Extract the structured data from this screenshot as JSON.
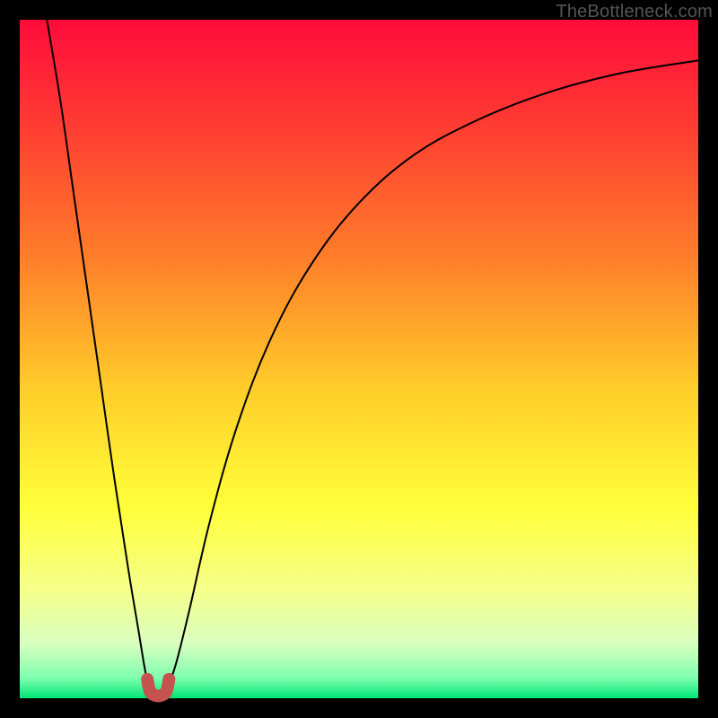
{
  "watermark": "TheBottleneck.com",
  "chart_data": {
    "type": "line",
    "title": "",
    "xlabel": "",
    "ylabel": "",
    "xlim": [
      0,
      100
    ],
    "ylim": [
      0,
      100
    ],
    "background_gradient": {
      "stops": [
        {
          "pos": 0.0,
          "color": "#ff0b3b"
        },
        {
          "pos": 0.15,
          "color": "#ff3a32"
        },
        {
          "pos": 0.35,
          "color": "#ff7e2a"
        },
        {
          "pos": 0.55,
          "color": "#ffcf2a"
        },
        {
          "pos": 0.72,
          "color": "#ffff3a"
        },
        {
          "pos": 0.84,
          "color": "#f5ff8a"
        },
        {
          "pos": 0.92,
          "color": "#d8ffc0"
        },
        {
          "pos": 0.97,
          "color": "#7fffb0"
        },
        {
          "pos": 1.0,
          "color": "#00e676"
        }
      ]
    },
    "series": [
      {
        "name": "bottleneck-curve",
        "stroke": "#000000",
        "stroke_width": 2,
        "points": [
          {
            "x": 4.0,
            "y": 100.0
          },
          {
            "x": 6.0,
            "y": 88.0
          },
          {
            "x": 8.0,
            "y": 74.0
          },
          {
            "x": 10.0,
            "y": 60.0
          },
          {
            "x": 12.0,
            "y": 46.0
          },
          {
            "x": 14.0,
            "y": 32.0
          },
          {
            "x": 16.0,
            "y": 19.0
          },
          {
            "x": 17.5,
            "y": 10.0
          },
          {
            "x": 18.5,
            "y": 4.0
          },
          {
            "x": 19.2,
            "y": 1.2
          },
          {
            "x": 20.0,
            "y": 0.2
          },
          {
            "x": 20.8,
            "y": 0.2
          },
          {
            "x": 21.6,
            "y": 1.2
          },
          {
            "x": 23.0,
            "y": 5.0
          },
          {
            "x": 25.0,
            "y": 13.0
          },
          {
            "x": 28.0,
            "y": 26.0
          },
          {
            "x": 32.0,
            "y": 40.0
          },
          {
            "x": 37.0,
            "y": 53.0
          },
          {
            "x": 43.0,
            "y": 64.0
          },
          {
            "x": 50.0,
            "y": 73.0
          },
          {
            "x": 58.0,
            "y": 80.0
          },
          {
            "x": 67.0,
            "y": 85.0
          },
          {
            "x": 77.0,
            "y": 89.0
          },
          {
            "x": 88.0,
            "y": 92.0
          },
          {
            "x": 100.0,
            "y": 94.0
          }
        ]
      },
      {
        "name": "minimum-marker",
        "stroke": "#c4524f",
        "stroke_width": 14,
        "linecap": "round",
        "points": [
          {
            "x": 18.8,
            "y": 2.8
          },
          {
            "x": 19.2,
            "y": 1.0
          },
          {
            "x": 20.0,
            "y": 0.4
          },
          {
            "x": 20.8,
            "y": 0.4
          },
          {
            "x": 21.6,
            "y": 1.0
          },
          {
            "x": 22.0,
            "y": 2.8
          }
        ]
      }
    ]
  }
}
